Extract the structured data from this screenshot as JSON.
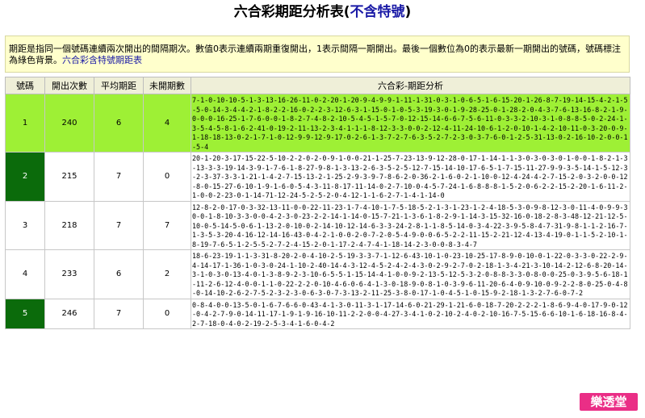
{
  "title": {
    "main": "六合彩期距分析表",
    "paren_open": "(",
    "link": "不含特號",
    "paren_close": ")"
  },
  "note": {
    "text": "期距是指同一個號碼連續兩次開出的間隔期次。數值0表示連續兩期重復開出，1表示間隔一期開出。最後一個數位為0的表示最新一期開出的號碼，號碼標注為綠色背景。",
    "link": "六合彩含特號期距表"
  },
  "table": {
    "headers": [
      "號碼",
      "開出次數",
      "平均期距",
      "未開期數",
      "六合彩-期距分析"
    ],
    "rows": [
      {
        "num": "1",
        "count": "240",
        "avg": "6",
        "unopened": "4",
        "seq": "7-1-0-10-10-5-1-3-13-16-26-11-0-2-20-1-20-9-4-9-9-1-11-1-31-0-3-1-0-6-5-1-6-15-20-1-26-8-7-19-14-15-4-2-1-5-5-0-14-3-4-4-2-1-8-2-2-16-0-2-2-3-12-6-3-1-15-0-1-0-5-3-19-3-0-1-9-28-25-0-1-28-2-0-4-3-7-6-13-16-8-2-1-9-0-0-0-16-25-1-7-6-0-0-1-8-2-7-4-8-2-10-5-4-5-1-5-7-0-12-15-14-6-6-7-5-6-11-0-3-3-2-10-3-1-0-8-8-5-0-2-24-1-3-5-4-5-8-1-6-2-41-0-19-2-11-13-2-3-4-1-1-1-8-12-3-3-0-0-2-12-4-11-24-10-6-1-2-0-10-1-4-2-10-11-0-3-20-0-9-1-18-18-13-0-2-1-7-1-0-12-9-9-12-9-17-0-2-6-1-3-7-2-7-6-3-5-2-7-2-3-0-3-7-6-0-1-2-5-31-13-0-2-16-10-2-0-0-1-5-4",
        "green": true,
        "dark": false
      },
      {
        "num": "2",
        "count": "215",
        "avg": "7",
        "unopened": "0",
        "seq": "20-1-20-3-17-15-22-5-10-2-2-0-2-0-9-1-0-0-21-1-25-7-23-13-9-12-28-0-17-1-14-1-1-3-0-3-0-3-0-1-0-0-1-8-2-1-3-13-3-3-19-14-3-9-1-7-6-1-8-27-9-8-1-3-13-2-6-3-5-2-5-12-7-15-14-10-17-6-5-1-7-15-11-27-9-9-3-5-14-1-5-12-3-2-3-37-3-3-1-21-1-4-2-7-15-13-2-1-25-2-9-3-9-7-8-6-2-0-36-2-1-6-0-2-1-10-0-12-4-24-4-2-7-15-2-0-3-2-0-0-12-8-0-15-27-6-10-1-9-1-6-0-5-4-3-11-8-17-11-14-0-2-7-10-0-4-5-7-24-1-6-8-8-8-1-5-2-0-6-2-2-15-2-20-1-6-11-2-1-0-0-2-23-0-1-14-71-12-24-5-2-5-2-0-4-12-1-1-6-2-7-1-4-1-14-0",
        "green": false,
        "dark": true
      },
      {
        "num": "3",
        "count": "218",
        "avg": "7",
        "unopened": "7",
        "seq": "12-8-2-0-17-0-3-32-13-11-0-0-22-11-23-1-7-4-10-1-7-5-18-5-2-1-3-1-23-1-2-4-18-5-3-0-9-8-12-3-0-11-4-0-9-9-30-0-1-8-10-3-3-0-0-4-2-3-0-23-2-2-14-1-14-0-15-7-21-1-3-6-1-8-2-9-1-14-3-15-32-16-0-18-2-8-3-48-12-21-12-5-10-0-5-14-5-0-6-1-13-2-0-10-0-2-14-10-12-14-6-3-3-24-2-8-1-1-8-5-14-0-3-4-22-3-9-5-8-4-7-31-9-8-1-1-2-16-7-1-3-5-3-20-4-16-12-14-16-43-0-4-2-1-0-0-2-0-7-2-0-5-4-9-0-0-6-5-2-2-11-15-2-21-12-4-13-4-19-0-1-1-5-2-10-1-8-19-7-6-5-1-2-5-5-2-7-2-4-15-2-0-1-17-2-4-7-4-1-18-14-2-3-0-0-8-3-4-7",
        "green": false,
        "dark": false
      },
      {
        "num": "4",
        "count": "233",
        "avg": "6",
        "unopened": "2",
        "seq": "18-6-23-19-1-1-3-31-8-20-2-0-4-10-2-5-19-3-3-7-1-12-6-43-10-1-0-23-10-25-17-8-9-0-10-0-1-22-0-3-3-0-22-2-9-4-14-17-1-36-1-0-3-0-24-1-10-2-40-14-4-3-12-4-5-2-4-2-4-3-0-2-9-2-7-0-2-18-1-3-4-21-3-10-14-2-12-6-8-20-14-3-1-0-3-0-13-4-0-1-3-8-9-2-3-10-6-5-5-1-15-14-4-1-0-0-9-2-13-5-12-5-3-2-0-8-8-3-3-0-8-0-0-25-0-3-9-5-6-18-1-11-2-6-12-4-0-0-1-1-0-22-2-2-0-10-4-6-0-6-4-1-3-0-18-9-0-8-1-0-3-9-6-11-20-6-4-0-9-10-0-9-2-2-8-0-25-0-4-8-0-14-10-2-6-2-7-5-2-3-2-3-0-6-3-0-7-3-13-2-11-25-3-8-0-17-1-0-4-5-1-0-15-9-2-18-1-3-2-7-6-0-7-2",
        "green": false,
        "dark": false
      },
      {
        "num": "5",
        "count": "246",
        "avg": "7",
        "unopened": "0",
        "seq": "0-8-4-0-0-13-5-0-1-6-7-6-6-0-43-4-1-3-0-11-3-1-17-14-6-0-21-29-1-21-6-0-18-7-20-2-2-2-1-8-6-9-4-0-17-9-0-12-0-4-2-7-9-0-14-11-17-1-9-1-9-16-10-11-2-2-0-0-4-27-3-4-1-0-2-10-2-4-0-2-10-16-7-5-15-6-6-10-1-6-18-16-8-4-2-7-18-0-4-0-2-19-2-5-3-4-1-6-0-4-2",
        "green": false,
        "dark": true
      }
    ]
  },
  "logo": {
    "text": "樂透堂"
  }
}
